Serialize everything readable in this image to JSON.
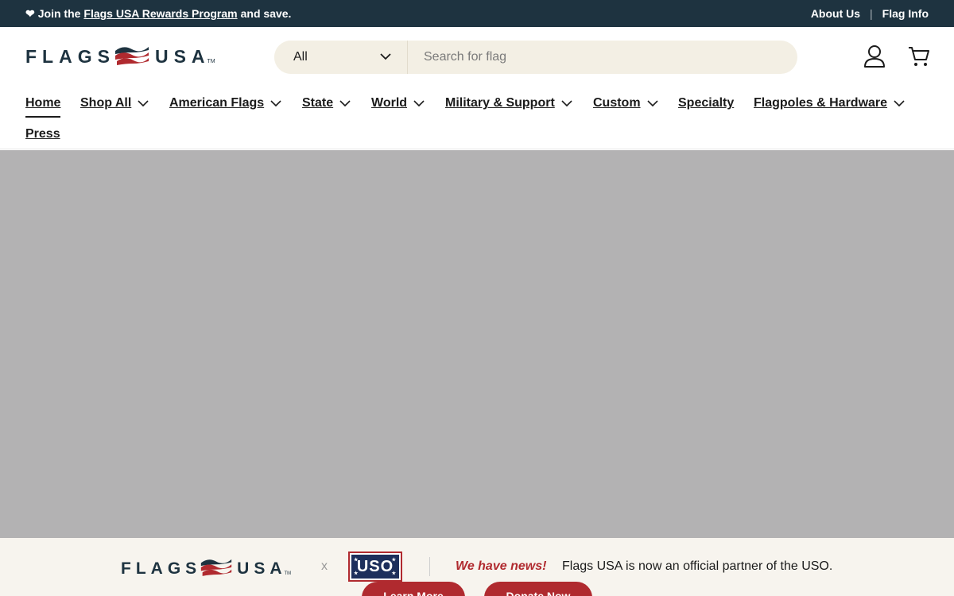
{
  "announcement": {
    "heart": "❤",
    "prefix": "Join the",
    "link": "Flags USA Rewards Program",
    "suffix": "and save.",
    "about": "About Us",
    "separator": "|",
    "flag_info": "Flag Info"
  },
  "header": {
    "logo_left": "FLAGS",
    "logo_right": "USA",
    "logo_tm": "TM",
    "search_category": "All",
    "search_placeholder": "Search for flag"
  },
  "nav": {
    "items": [
      {
        "label": "Home",
        "active": true,
        "dropdown": false
      },
      {
        "label": "Shop All",
        "dropdown": true
      },
      {
        "label": "American Flags",
        "dropdown": true
      },
      {
        "label": "State",
        "dropdown": true
      },
      {
        "label": "World",
        "dropdown": true
      },
      {
        "label": "Military & Support",
        "dropdown": true
      },
      {
        "label": "Custom",
        "dropdown": true
      },
      {
        "label": "Specialty",
        "dropdown": false
      },
      {
        "label": "Flagpoles & Hardware",
        "dropdown": true
      },
      {
        "label": "Press",
        "dropdown": false
      }
    ]
  },
  "partner": {
    "logo_left": "FLAGS",
    "logo_right": "USA",
    "logo_tm": "TM",
    "x": "x",
    "uso": "USO",
    "news": "We have news!",
    "text": "Flags USA is now an official partner of the USO.",
    "learn": "Learn More",
    "donate": "Donate Now"
  },
  "colors": {
    "topbar": "#1e3340",
    "accent_red": "#b02a2f",
    "hero_placeholder": "#b3b2b3",
    "search_bg": "#f3efe4"
  },
  "icons": {
    "account": "user-icon",
    "cart": "cart-icon",
    "dropdown": "chevron-down-icon",
    "logo": "flag-wave-icon"
  }
}
